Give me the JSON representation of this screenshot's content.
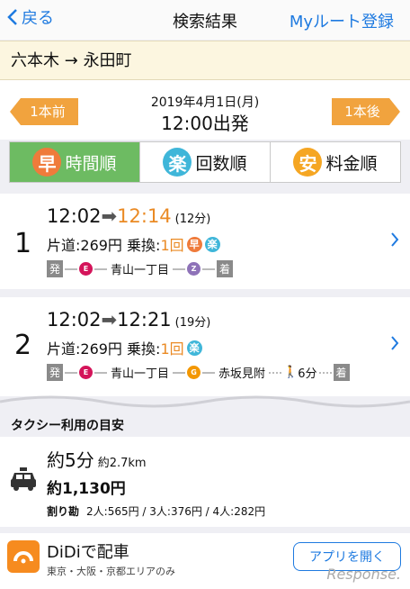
{
  "nav": {
    "back_label": "戻る",
    "title": "検索結果",
    "register_label": "Myルート登録"
  },
  "route": {
    "from": "六本木",
    "arrow": "→",
    "to": "永田町"
  },
  "date_bar": {
    "prev_label": "1本前",
    "next_label": "1本後",
    "date": "2019年4月1日(月)",
    "time": "12:00出発"
  },
  "tabs": [
    {
      "badge": "早",
      "label": "時間順",
      "active": true
    },
    {
      "badge": "楽",
      "label": "回数順",
      "active": false
    },
    {
      "badge": "安",
      "label": "料金順",
      "active": false
    }
  ],
  "results": [
    {
      "num": "1",
      "dep": "12:02",
      "arr": "12:14",
      "dur": "(12分)",
      "fare": "片道:269円",
      "transfer_label": "乗換:",
      "transfers": "1回",
      "badges": [
        "早",
        "楽"
      ],
      "dep_tag": "発",
      "arr_tag": "着",
      "line1_mark": "E",
      "station": "青山一丁目",
      "line2_mark": "Z"
    },
    {
      "num": "2",
      "dep": "12:02",
      "arr": "12:21",
      "dur": "(19分)",
      "fare": "片道:269円",
      "transfer_label": "乗換:",
      "transfers": "1回",
      "badges": [
        "楽"
      ],
      "dep_tag": "発",
      "arr_tag": "着",
      "line1_mark": "E",
      "station": "青山一丁目",
      "line2_mark": "G",
      "station2": "赤坂見附",
      "walk": "6分"
    }
  ],
  "taxi": {
    "heading": "タクシー利用の目安",
    "time": "約5分",
    "distance": "約2.7km",
    "fare": "約1,130円",
    "split_label": "割り勘",
    "split": "2人:565円 / 3人:376円 / 4人:282円"
  },
  "didi": {
    "name": "DiDiで配車",
    "area": "東京・大阪・京都エリアのみ",
    "open_label": "アプリを開く"
  },
  "watermark": "Response.",
  "colors": {
    "accent": "#1e7ae0",
    "orange": "#f1a33e",
    "active_tab": "#6dbb62"
  }
}
